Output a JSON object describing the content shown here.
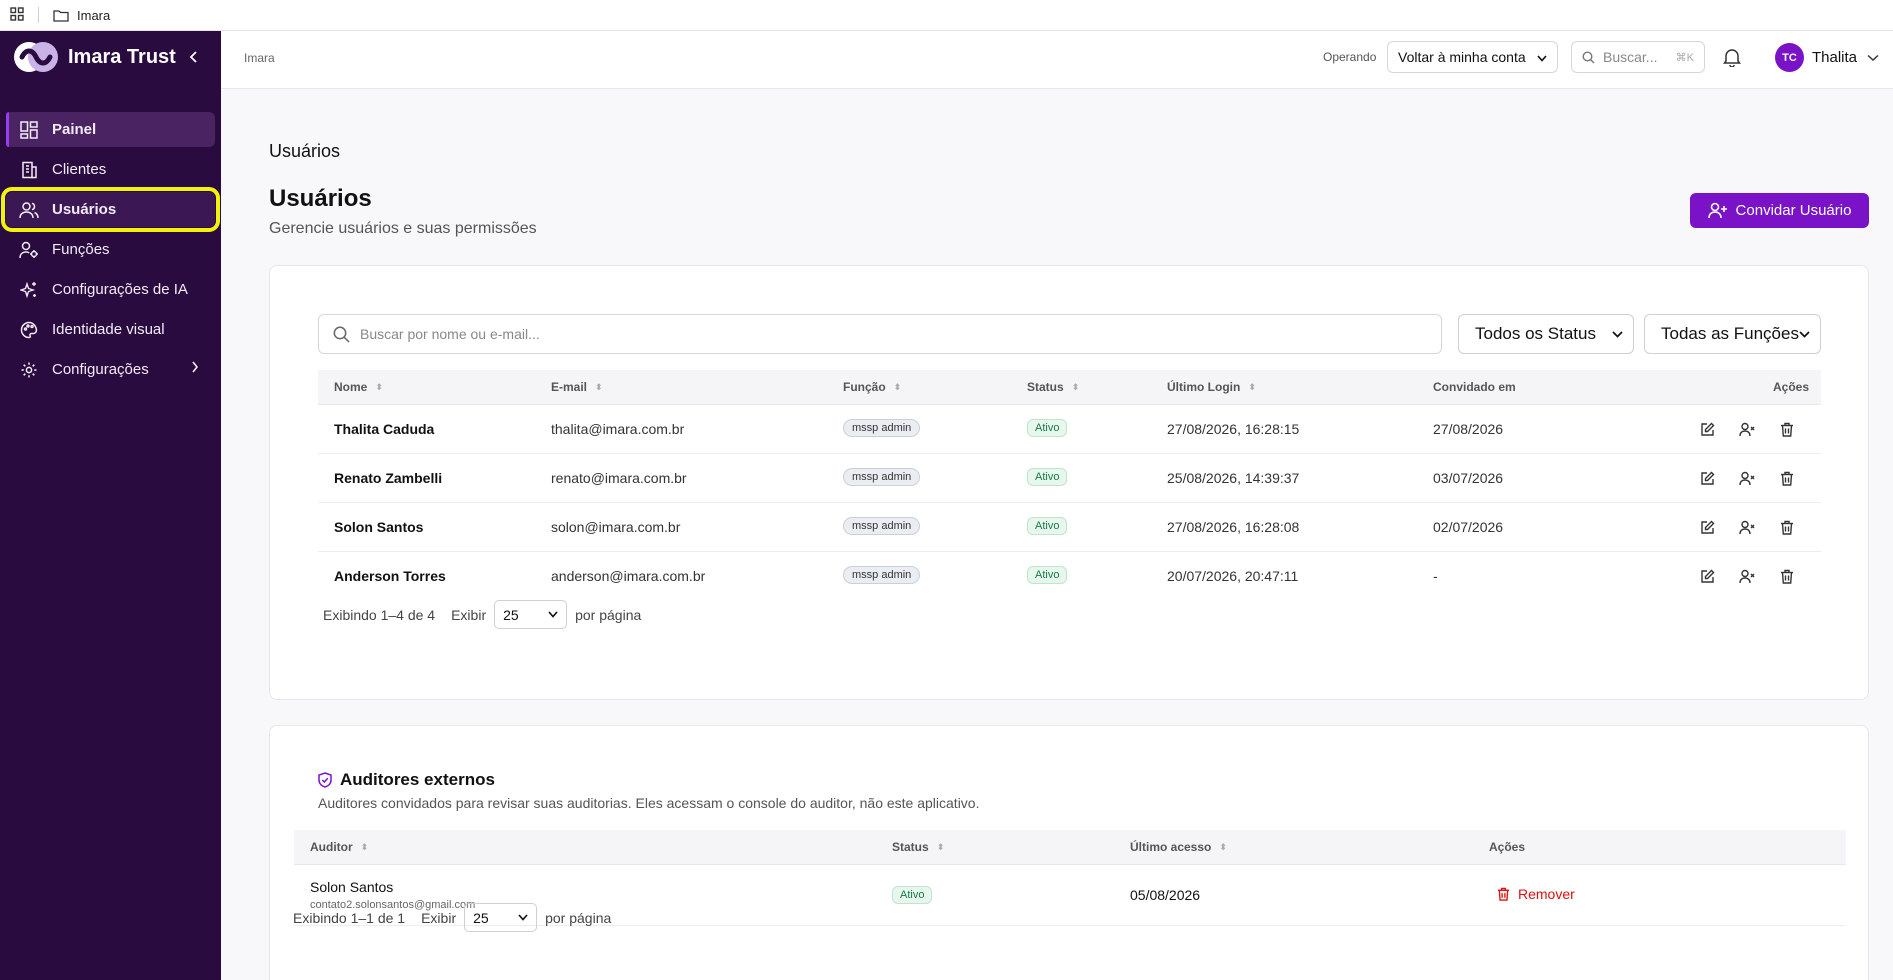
{
  "topbar": {
    "folder_name": "Imara"
  },
  "sidebar": {
    "brand": "Imara Trust",
    "items": [
      {
        "label": "Painel"
      },
      {
        "label": "Clientes"
      },
      {
        "label": "Usuários"
      },
      {
        "label": "Funções"
      },
      {
        "label": "Configurações de IA"
      },
      {
        "label": "Identidade visual"
      },
      {
        "label": "Configurações"
      }
    ]
  },
  "header": {
    "breadcrumb": "Imara",
    "operando_label": "Operando",
    "operando_value": "Voltar à minha conta",
    "search_placeholder": "Buscar...",
    "search_shortcut": "⌘K",
    "avatar_initials": "TC",
    "user_name": "Thalita"
  },
  "main": {
    "breadcrumb": "Usuários",
    "title": "Usuários",
    "subtitle": "Gerencie usuários e suas permissões",
    "invite_button": "Convidar Usuário",
    "search_placeholder": "Buscar por nome ou e-mail...",
    "filter_status": "Todos os Status",
    "filter_roles": "Todas as Funções",
    "columns": {
      "name": "Nome",
      "email": "E-mail",
      "role": "Função",
      "status": "Status",
      "last_login": "Último Login",
      "invited": "Convidado em",
      "actions": "Ações"
    },
    "rows": [
      {
        "name": "Thalita Caduda",
        "email": "thalita@imara.com.br",
        "role": "mssp admin",
        "status": "Ativo",
        "last_login": "27/08/2026, 16:28:15",
        "invited": "27/08/2026"
      },
      {
        "name": "Renato Zambelli",
        "email": "renato@imara.com.br",
        "role": "mssp admin",
        "status": "Ativo",
        "last_login": "25/08/2026, 14:39:37",
        "invited": "03/07/2026"
      },
      {
        "name": "Solon Santos",
        "email": "solon@imara.com.br",
        "role": "mssp admin",
        "status": "Ativo",
        "last_login": "27/08/2026, 16:28:08",
        "invited": "02/07/2026"
      },
      {
        "name": "Anderson Torres",
        "email": "anderson@imara.com.br",
        "role": "mssp admin",
        "status": "Ativo",
        "last_login": "20/07/2026, 20:47:11",
        "invited": "-"
      }
    ],
    "pagination": {
      "showing": "Exibindo 1–4 de 4",
      "show_label": "Exibir",
      "page_size": "25",
      "per_page": "por página"
    }
  },
  "auditors": {
    "title": "Auditores externos",
    "subtitle": "Auditores convidados para revisar suas auditorias. Eles acessam o console do auditor, não este aplicativo.",
    "columns": {
      "auditor": "Auditor",
      "status": "Status",
      "last_access": "Último acesso",
      "actions": "Ações"
    },
    "rows": [
      {
        "name": "Solon Santos",
        "email": "contato2.solonsantos@gmail.com",
        "status": "Ativo",
        "last_access": "05/08/2026",
        "action": "Remover"
      }
    ],
    "pagination": {
      "showing": "Exibindo 1–1 de 1",
      "show_label": "Exibir",
      "page_size": "25",
      "per_page": "por página"
    }
  },
  "colors": {
    "sidebar_bg": "#2a0b3f",
    "accent": "#7a12c8",
    "highlight": "#f2f20a",
    "status_green": "#177a45",
    "danger": "#dd1111"
  }
}
